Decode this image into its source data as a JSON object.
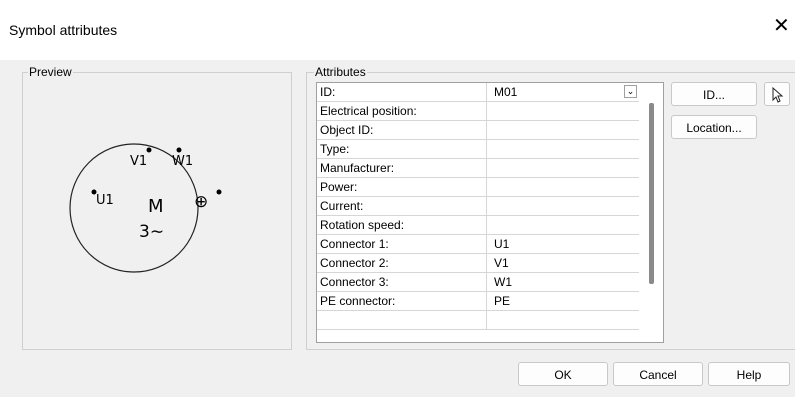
{
  "dialog": {
    "title": "Symbol attributes",
    "close_glyph": "✕"
  },
  "preview": {
    "label": "Preview",
    "symbol": {
      "connectors": [
        "V1",
        "W1",
        "U1"
      ],
      "center_letter": "M",
      "phase_label": "3∼",
      "earth_glyph": "⊕"
    }
  },
  "attributes": {
    "label": "Attributes",
    "rows": [
      {
        "key": "ID:",
        "value": "M01"
      },
      {
        "key": "Electrical position:",
        "value": ""
      },
      {
        "key": "Object ID:",
        "value": ""
      },
      {
        "key": "Type:",
        "value": ""
      },
      {
        "key": "Manufacturer:",
        "value": ""
      },
      {
        "key": "Power:",
        "value": ""
      },
      {
        "key": "Current:",
        "value": ""
      },
      {
        "key": "Rotation speed:",
        "value": ""
      },
      {
        "key": "Connector 1:",
        "value": "U1"
      },
      {
        "key": "Connector 2:",
        "value": "V1"
      },
      {
        "key": "Connector 3:",
        "value": "W1"
      },
      {
        "key": "PE connector:",
        "value": "PE"
      },
      {
        "key": "",
        "value": ""
      }
    ],
    "id_dropdown_glyph": "⌄"
  },
  "side_buttons": {
    "id_label": "ID...",
    "location_label": "Location...",
    "pick_icon": "pointer-icon"
  },
  "footer": {
    "ok": "OK",
    "cancel": "Cancel",
    "help": "Help"
  }
}
